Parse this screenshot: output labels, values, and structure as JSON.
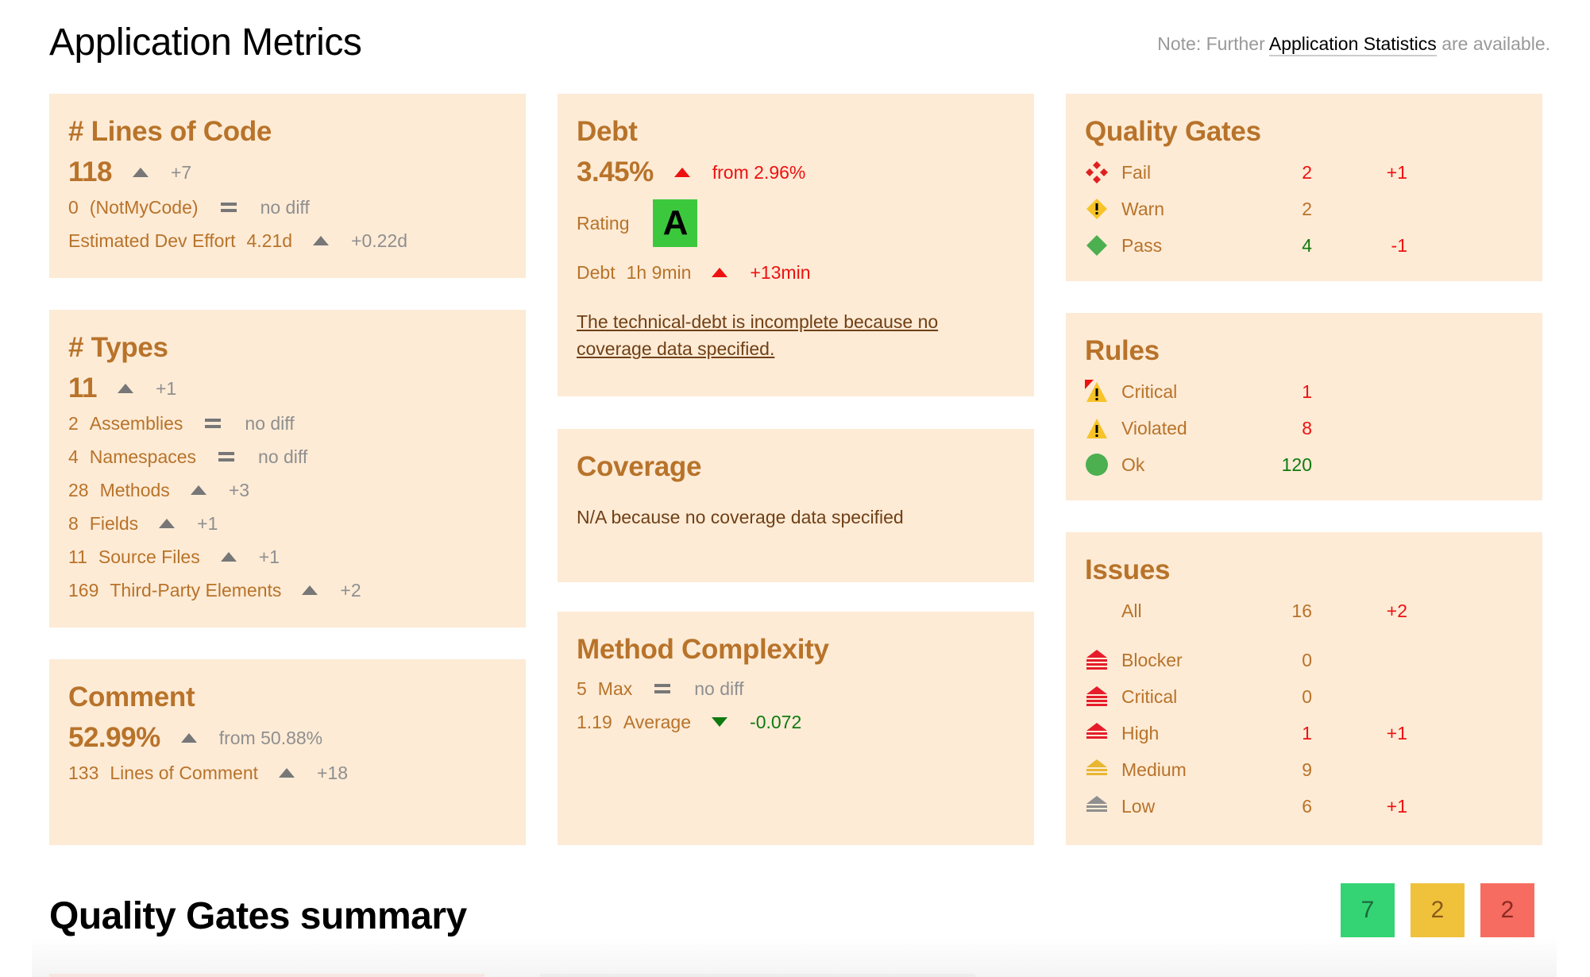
{
  "header": {
    "title": "Application Metrics",
    "note_prefix": "Note: Further",
    "note_link": "Application Statistics",
    "note_suffix": "are available."
  },
  "loc": {
    "title": "# Lines of Code",
    "value": "118",
    "trend": "up",
    "diff": "+7",
    "notmycode_value": "0",
    "notmycode_label": "(NotMyCode)",
    "notmycode_diff": "no diff",
    "effort_label": "Estimated Dev Effort",
    "effort_value": "4.21d",
    "effort_diff": "+0.22d"
  },
  "types": {
    "title": "# Types",
    "value": "11",
    "diff": "+1",
    "rows": [
      {
        "value": "2",
        "label": "Assemblies",
        "trend": "equal",
        "diff": "no diff"
      },
      {
        "value": "4",
        "label": "Namespaces",
        "trend": "equal",
        "diff": "no diff"
      },
      {
        "value": "28",
        "label": "Methods",
        "trend": "up",
        "diff": "+3"
      },
      {
        "value": "8",
        "label": "Fields",
        "trend": "up",
        "diff": "+1"
      },
      {
        "value": "11",
        "label": "Source Files",
        "trend": "up",
        "diff": "+1"
      },
      {
        "value": "169",
        "label": "Third-Party Elements",
        "trend": "up",
        "diff": "+2"
      }
    ]
  },
  "comment": {
    "title": "Comment",
    "value": "52.99%",
    "diff": "from 50.88%",
    "lines_value": "133",
    "lines_label": "Lines of Comment",
    "lines_diff": "+18"
  },
  "debt": {
    "title": "Debt",
    "value": "3.45%",
    "diff": "from 2.96%",
    "rating_label": "Rating",
    "rating": "A",
    "time_label": "Debt",
    "time_value": "1h 9min",
    "time_diff": "+13min",
    "note": "The technical-debt is incomplete because no coverage data specified."
  },
  "coverage": {
    "title": "Coverage",
    "text": "N/A because no coverage data specified"
  },
  "complexity": {
    "title": "Method Complexity",
    "max_value": "5",
    "max_label": "Max",
    "max_diff": "no diff",
    "avg_value": "1.19",
    "avg_label": "Average",
    "avg_diff": "-0.072"
  },
  "quality_gates": {
    "title": "Quality Gates",
    "rows": [
      {
        "icon": "fail-diamond-icon",
        "label": "Fail",
        "value": "2",
        "diff": "+1"
      },
      {
        "icon": "warn-diamond-icon",
        "label": "Warn",
        "value": "2",
        "diff": ""
      },
      {
        "icon": "pass-diamond-icon",
        "label": "Pass",
        "value": "4",
        "diff": "-1"
      }
    ]
  },
  "rules": {
    "title": "Rules",
    "rows": [
      {
        "icon": "critical-warning-icon",
        "label": "Critical",
        "value": "1"
      },
      {
        "icon": "warning-icon",
        "label": "Violated",
        "value": "8"
      },
      {
        "icon": "ok-circle-icon",
        "label": "Ok",
        "value": "120"
      }
    ]
  },
  "issues": {
    "title": "Issues",
    "all_label": "All",
    "all_value": "16",
    "all_diff": "+2",
    "rows": [
      {
        "icon": "blocker-severity-icon",
        "label": "Blocker",
        "value": "0",
        "diff": ""
      },
      {
        "icon": "critical-severity-icon",
        "label": "Critical",
        "value": "0",
        "diff": ""
      },
      {
        "icon": "high-severity-icon",
        "label": "High",
        "value": "1",
        "diff": "+1"
      },
      {
        "icon": "medium-severity-icon",
        "label": "Medium",
        "value": "9",
        "diff": ""
      },
      {
        "icon": "low-severity-icon",
        "label": "Low",
        "value": "6",
        "diff": "+1"
      }
    ]
  },
  "summary": {
    "title": "Quality Gates summary",
    "pass_count": "7",
    "warn_count": "2",
    "fail_count": "2",
    "colors": {
      "pass": "#34d474",
      "warn": "#f0c23c",
      "fail": "#f76c60"
    }
  }
}
